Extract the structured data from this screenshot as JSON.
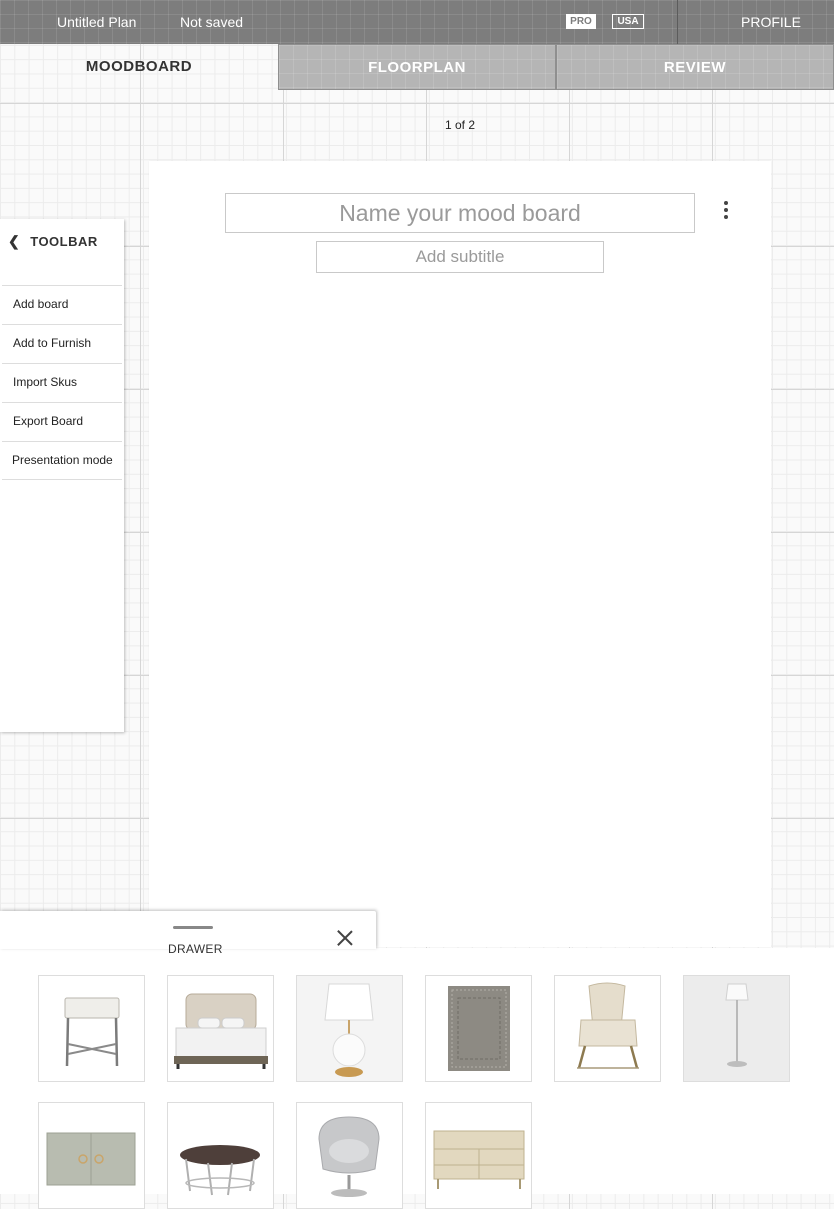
{
  "header": {
    "plan_title": "Untitled Plan",
    "save_status": "Not saved",
    "badge_pro": "PRO",
    "badge_region": "USA",
    "profile_label": "PROFILE"
  },
  "tabs": [
    {
      "label": "MOODBOARD",
      "active": true
    },
    {
      "label": "FLOORPLAN",
      "active": false
    },
    {
      "label": "REVIEW",
      "active": false
    }
  ],
  "pager": {
    "text": "1 of 2"
  },
  "board": {
    "title_placeholder": "Name your mood board",
    "subtitle_placeholder": "Add subtitle",
    "menu_icon": "more-vertical-icon"
  },
  "toolbar": {
    "title": "TOOLBAR",
    "collapse_icon": "chevron-left-icon",
    "items": [
      {
        "label": "Add board"
      },
      {
        "label": "Add to Furnish"
      },
      {
        "label": "Import Skus"
      },
      {
        "label": "Export Board"
      },
      {
        "label": "Presentation mode"
      }
    ]
  },
  "drawer": {
    "label": "DRAWER",
    "close_icon": "close-icon",
    "products": [
      {
        "icon": "side-table-icon"
      },
      {
        "icon": "upholstered-bed-icon"
      },
      {
        "icon": "table-lamp-icon"
      },
      {
        "icon": "area-rug-icon"
      },
      {
        "icon": "lounge-chair-icon"
      },
      {
        "icon": "floor-lamp-icon"
      },
      {
        "icon": "sideboard-icon"
      },
      {
        "icon": "coffee-table-icon"
      },
      {
        "icon": "swivel-chair-icon"
      },
      {
        "icon": "dresser-icon"
      }
    ]
  },
  "colors": {
    "topbar": "#7d7d7d",
    "tab_inactive": "#b5b5b5",
    "canvas": "#ffffff"
  }
}
